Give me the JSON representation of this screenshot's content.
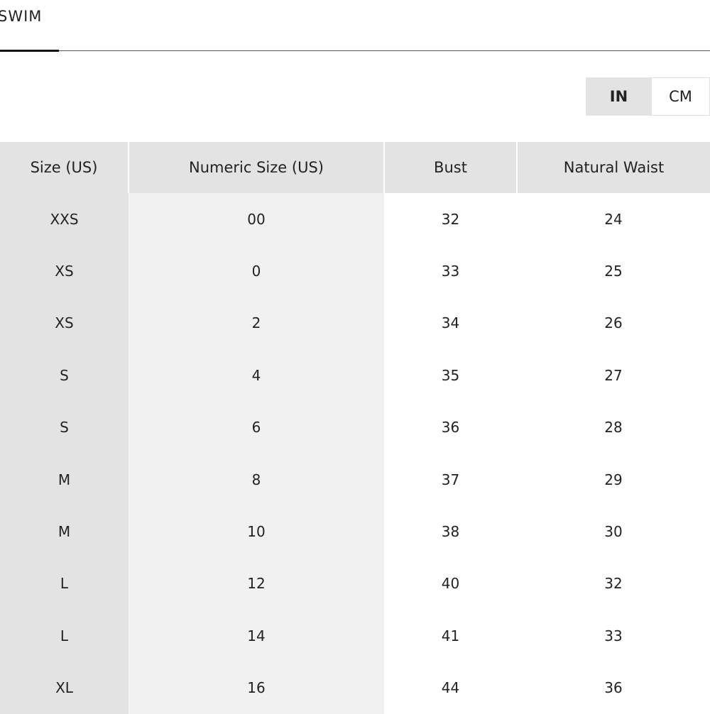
{
  "tabs": [
    {
      "label": "SWIM",
      "active": true
    }
  ],
  "unit_toggle": {
    "options": [
      "IN",
      "CM"
    ],
    "selected": "IN"
  },
  "size_table": {
    "headers": [
      "Size (US)",
      "Numeric Size (US)",
      "Bust",
      "Natural Waist"
    ],
    "rows": [
      [
        "XXS",
        "00",
        "32",
        "24"
      ],
      [
        "XS",
        "0",
        "33",
        "25"
      ],
      [
        "XS",
        "2",
        "34",
        "26"
      ],
      [
        "S",
        "4",
        "35",
        "27"
      ],
      [
        "S",
        "6",
        "36",
        "28"
      ],
      [
        "M",
        "8",
        "37",
        "29"
      ],
      [
        "M",
        "10",
        "38",
        "30"
      ],
      [
        "L",
        "12",
        "40",
        "32"
      ],
      [
        "L",
        "14",
        "41",
        "33"
      ],
      [
        "XL",
        "16",
        "44",
        "36"
      ]
    ]
  },
  "colors": {
    "header_bg": "#e3e3e3",
    "first_column_bg": "#e3e3e3",
    "second_column_bg": "#f1f1f1",
    "tab_indicator": "#111111",
    "text": "#222222"
  }
}
